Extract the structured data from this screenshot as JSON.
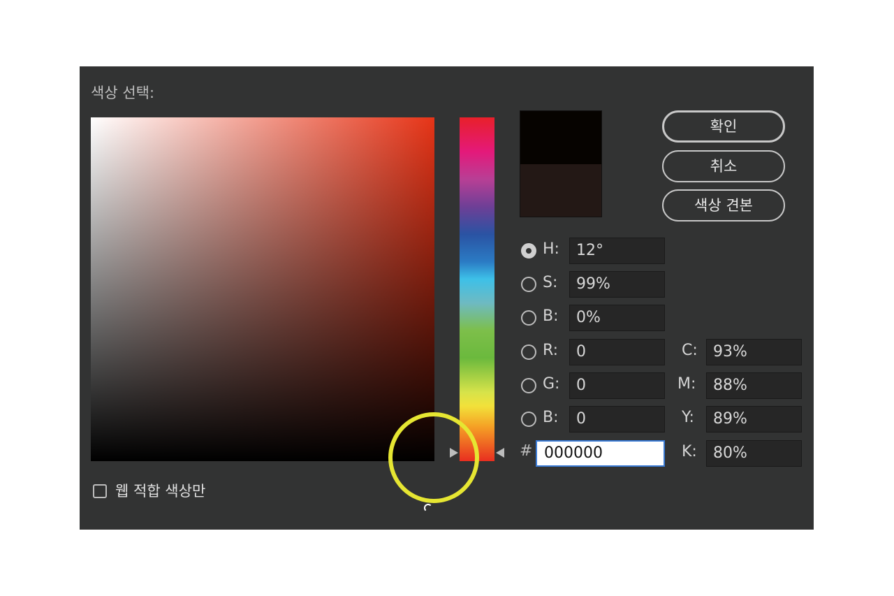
{
  "dialog": {
    "title": "색상 선택:",
    "new_color": "#060300",
    "current_color": "#231815"
  },
  "buttons": {
    "ok": "확인",
    "cancel": "취소",
    "swatches": "색상 견본"
  },
  "hsb": {
    "h_label": "H:",
    "h_value": "12°",
    "s_label": "S:",
    "s_value": "99%",
    "b_label": "B:",
    "b_value": "0%"
  },
  "rgb": {
    "r_label": "R:",
    "r_value": "0",
    "g_label": "G:",
    "g_value": "0",
    "b_label": "B:",
    "b_value": "0"
  },
  "cmyk": {
    "c_label": "C:",
    "c_value": "93%",
    "m_label": "M:",
    "m_value": "88%",
    "y_label": "Y:",
    "y_value": "89%",
    "k_label": "K:",
    "k_value": "80%"
  },
  "hex": {
    "label": "#",
    "value": "000000"
  },
  "web_only": {
    "label": "웹 적합 색상만",
    "checked": false
  },
  "selected_mode": "H",
  "highlight_color": "#e6e632"
}
